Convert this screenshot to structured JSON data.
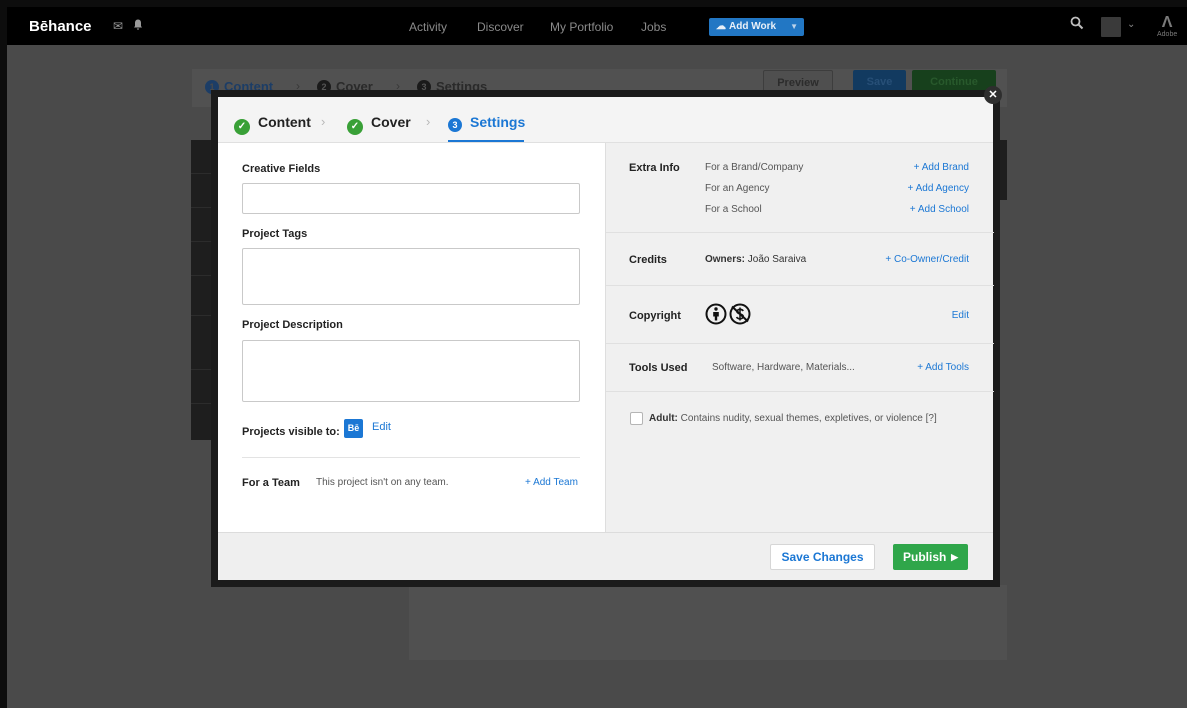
{
  "topbar": {
    "brand": "Bēhance",
    "nav": [
      "Activity",
      "Discover",
      "My Portfolio",
      "Jobs"
    ],
    "add_work": "Add Work",
    "adobe": "Adobe"
  },
  "background_editor": {
    "steps": [
      {
        "num": "1",
        "label": "Content"
      },
      {
        "num": "2",
        "label": "Cover"
      },
      {
        "num": "3",
        "label": "Settings"
      }
    ],
    "preview": "Preview",
    "save": "Save",
    "continue": "Continue"
  },
  "modal": {
    "steps": [
      {
        "label": "Content",
        "state": "done"
      },
      {
        "label": "Cover",
        "state": "done"
      },
      {
        "label": "Settings",
        "state": "current",
        "num": "3"
      }
    ],
    "left": {
      "creative_fields_label": "Creative Fields",
      "creative_fields_value": "",
      "project_tags_label": "Project Tags",
      "project_tags_value": "",
      "project_description_label": "Project Description",
      "project_description_value": "",
      "visible_to_label": "Projects visible to:",
      "visible_badge": "Bē",
      "visible_edit": "Edit",
      "team_label": "For a Team",
      "team_text": "This project isn't on any team.",
      "team_add": "+ Add Team"
    },
    "right": {
      "extra_info": {
        "label": "Extra Info",
        "rows": [
          {
            "text": "For a Brand/Company",
            "action": "+ Add Brand"
          },
          {
            "text": "For an Agency",
            "action": "+ Add Agency"
          },
          {
            "text": "For a School",
            "action": "+ Add School"
          }
        ]
      },
      "credits": {
        "label": "Credits",
        "owners_label": "Owners:",
        "owners_value": "João Saraiva",
        "action": "+ Co-Owner/Credit"
      },
      "copyright": {
        "label": "Copyright",
        "icons": [
          "cc-attribution-icon",
          "cc-noncommercial-icon"
        ],
        "action": "Edit"
      },
      "tools": {
        "label": "Tools Used",
        "placeholder": "Software, Hardware, Materials...",
        "action": "+ Add Tools"
      },
      "adult": {
        "label": "Adult:",
        "text": "Contains nudity, sexual themes, expletives, or violence [?]",
        "checked": false
      }
    },
    "footer": {
      "save_changes": "Save Changes",
      "publish": "Publish"
    }
  },
  "colors": {
    "accent": "#1b77d4",
    "success": "#39a037",
    "publish": "#2fa64a"
  }
}
